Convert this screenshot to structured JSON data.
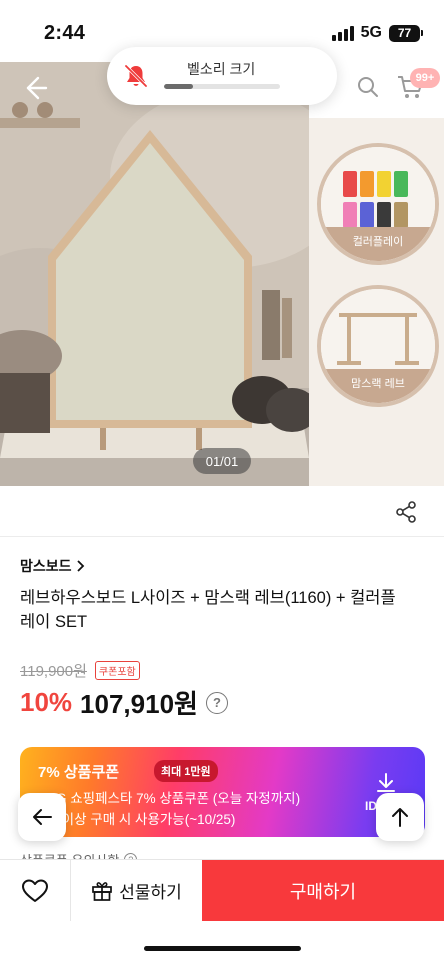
{
  "status_bar": {
    "time": "2:44",
    "network": "5G",
    "battery": "77"
  },
  "volume_hud": {
    "label": "벨소리 크기",
    "level": 0.25
  },
  "gallery": {
    "counter": "01/01",
    "side_thumbs": [
      {
        "label": "컬러플레이"
      },
      {
        "label": "맘스랙 레브"
      }
    ]
  },
  "header": {
    "cart_badge": "99+"
  },
  "product": {
    "category": "맘스보드",
    "title": "레브하우스보드 L사이즈 + 맘스랙 레브(1160) + 컬러플레이 SET",
    "original_price": "119,900원",
    "coupon_included_tag": "쿠폰포함",
    "discount": "10%",
    "price": "107,910원",
    "info_symbol": "?"
  },
  "coupon": {
    "title": "7% 상품쿠폰",
    "max_badge": "최대 1만원",
    "line1": "SSG 쇼핑페스타 7% 상품쿠폰 (오늘 자정까지)",
    "line2": "1원 이상 구매 시 사용가능(~10/25)",
    "download_label": "ID"
  },
  "coupon_notice": {
    "label": "상품쿠폰 유의사항",
    "symbol": "?"
  },
  "bottom_bar": {
    "gift_label": "선물하기",
    "buy_label": "구매하기"
  },
  "colors": {
    "accent": "#f8393c",
    "discount": "#f0453e"
  }
}
